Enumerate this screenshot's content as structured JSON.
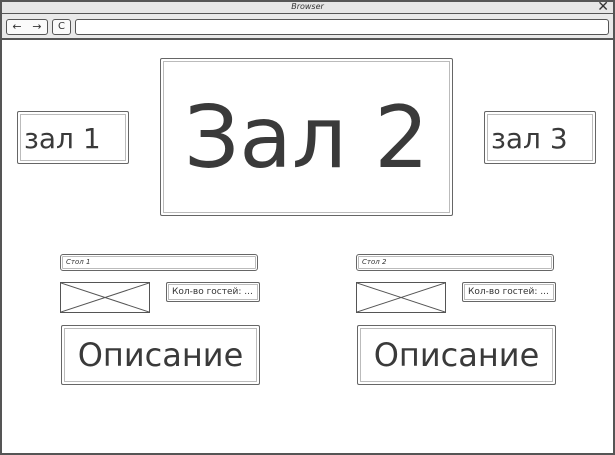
{
  "window": {
    "title": "Browser"
  },
  "toolbar": {
    "back_glyph": "←",
    "forward_glyph": "→",
    "reload_glyph": "C",
    "address": ""
  },
  "halls": {
    "hall1": "зал 1",
    "hall2": "Зал 2",
    "hall3": "зал 3"
  },
  "tables": [
    {
      "name": "Стол 1",
      "guests": "Кол-во гостей: ...",
      "description": "Описание"
    },
    {
      "name": "Стол 2",
      "guests": "Кол-во гостей: ...",
      "description": "Описание"
    }
  ],
  "icons": {
    "close": "close-icon",
    "back": "arrow-left-icon",
    "forward": "arrow-right-icon",
    "reload": "reload-icon"
  }
}
